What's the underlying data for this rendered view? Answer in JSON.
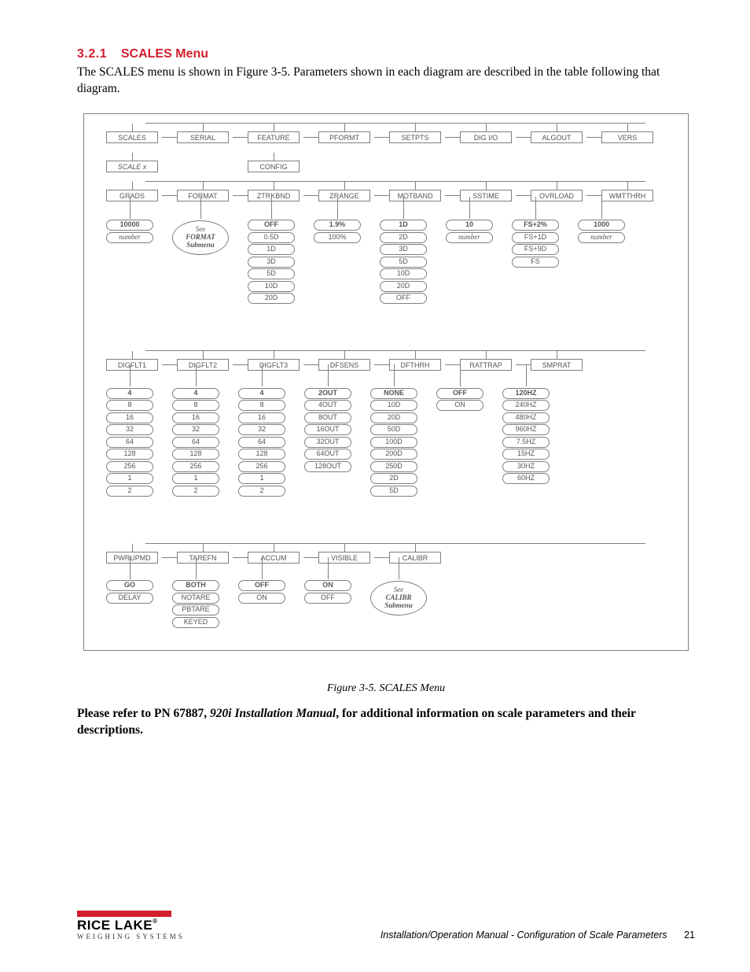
{
  "heading": {
    "number": "3.2.1",
    "title": "SCALES Menu"
  },
  "intro": "The SCALES menu is shown in Figure 3-5. Parameters shown in each diagram are described in the table following that diagram.",
  "level1": [
    "SCALES",
    "SERIAL",
    "FEATURE",
    "PFORMT",
    "SETPTS",
    "DIG I/O",
    "ALGOUT",
    "VERS"
  ],
  "level2": {
    "scalex": "SCALE x",
    "config": "CONFIG"
  },
  "level3": [
    "GRADS",
    "FORMAT",
    "ZTRKBND",
    "ZRANGE",
    "MOTBAND",
    "SSTIME",
    "OVRLOAD",
    "WMTTHRH"
  ],
  "opts3": {
    "grads": {
      "bold": "10000",
      "rest": [
        "number"
      ],
      "italic_first_rest": true
    },
    "format": {
      "bubble": [
        "See",
        "FORMAT",
        "Submenu"
      ]
    },
    "ztrkbnd": {
      "bold": "OFF",
      "rest": [
        "0.5D",
        "1D",
        "3D",
        "5D",
        "10D",
        "20D"
      ]
    },
    "zrange": {
      "bold": "1.9%",
      "rest": [
        "100%"
      ]
    },
    "motband": {
      "bold": "1D",
      "rest": [
        "2D",
        "3D",
        "5D",
        "10D",
        "20D",
        "OFF"
      ]
    },
    "sstime": {
      "bold": "10",
      "rest": [
        "number"
      ],
      "italic_first_rest": true
    },
    "ovrload": {
      "bold": "FS+2%",
      "rest": [
        "FS+1D",
        "FS+9D",
        "FS"
      ]
    },
    "wmtthrh": {
      "bold": "1000",
      "rest": [
        "number"
      ],
      "italic_first_rest": true
    }
  },
  "level4": [
    "DIGFLT1",
    "DIGFLT2",
    "DIGFLT3",
    "DFSENS",
    "DFTHRH",
    "RATTRAP",
    "SMPRAT"
  ],
  "opts4": {
    "digflt1": {
      "bold": "4",
      "rest": [
        "8",
        "16",
        "32",
        "64",
        "128",
        "256",
        "1",
        "2"
      ]
    },
    "digflt2": {
      "bold": "4",
      "rest": [
        "8",
        "16",
        "32",
        "64",
        "128",
        "256",
        "1",
        "2"
      ]
    },
    "digflt3": {
      "bold": "4",
      "rest": [
        "8",
        "16",
        "32",
        "64",
        "128",
        "256",
        "1",
        "2"
      ]
    },
    "dfsens": {
      "bold": "2OUT",
      "rest": [
        "4OUT",
        "8OUT",
        "16OUT",
        "32OUT",
        "64OUT",
        "128OUT"
      ]
    },
    "dfthrh": {
      "bold": "NONE",
      "rest": [
        "10D",
        "20D",
        "50D",
        "100D",
        "200D",
        "250D",
        "2D",
        "5D"
      ]
    },
    "rattrap": {
      "bold": "OFF",
      "rest": [
        "ON"
      ]
    },
    "smprat": {
      "bold": "120HZ",
      "rest": [
        "240HZ",
        "480HZ",
        "960HZ",
        "7.5HZ",
        "15HZ",
        "30HZ",
        "60HZ"
      ]
    }
  },
  "level5": [
    "PWRUPMD",
    "TAREFN",
    "ACCUM",
    "VISIBLE",
    "CALIBR"
  ],
  "opts5": {
    "pwrupmd": {
      "bold": "GO",
      "rest": [
        "DELAY"
      ]
    },
    "tarefn": {
      "bold": "BOTH",
      "rest": [
        "NOTARE",
        "PBTARE",
        "KEYED"
      ]
    },
    "accum": {
      "bold": "OFF",
      "rest": [
        "ON"
      ]
    },
    "visible": {
      "bold": "ON",
      "rest": [
        "OFF"
      ]
    },
    "calibr": {
      "bubble": [
        "See",
        "CALIBR",
        "Submenu"
      ]
    }
  },
  "caption": "Figure 3-5. SCALES Menu",
  "ref": {
    "pre": "Please refer to PN 67887, ",
    "ital": "920i Installation Manual",
    "post": ", for additional information on scale parameters and their descriptions."
  },
  "footer": {
    "logo_main": "RICE LAKE",
    "logo_sub": "WEIGHING SYSTEMS",
    "doc": "Installation/Operation Manual - Configuration of Scale Parameters",
    "page": "21"
  }
}
